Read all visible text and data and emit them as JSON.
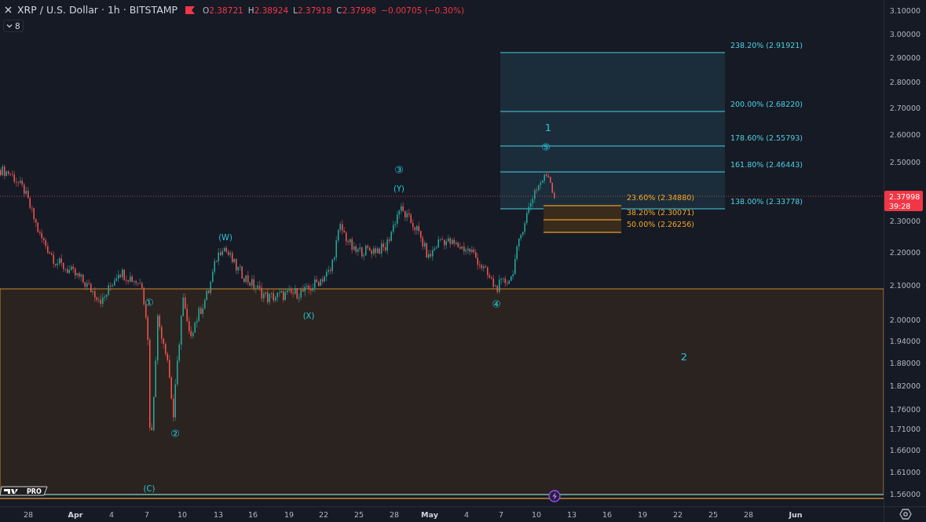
{
  "legend": {
    "symbol": "XRP / U.S. Dollar · 1h · BITSTAMP",
    "values": [
      {
        "key": "O",
        "value": "2.38721"
      },
      {
        "key": "H",
        "value": "2.38924"
      },
      {
        "key": "L",
        "value": "2.37918"
      },
      {
        "key": "C",
        "value": "2.37998"
      }
    ],
    "change": "−0.00705 (−0.30%)"
  },
  "indicators_toggle": {
    "count": "8"
  },
  "fib_extension": [
    {
      "label": "238.20% (2.91921)"
    },
    {
      "label": "200.00% (2.68220)"
    },
    {
      "label": "178.60% (2.55793)"
    },
    {
      "label": "161.80% (2.46443)"
    },
    {
      "label": "138.00% (2.33778)"
    }
  ],
  "fib_retracement": [
    {
      "label": "23.60% (2.34880)"
    },
    {
      "label": "38.20% (2.30071)"
    },
    {
      "label": "50.00% (2.26256)"
    }
  ],
  "wave_labels": [
    {
      "text": "①"
    },
    {
      "text": "②"
    },
    {
      "text": "③"
    },
    {
      "text": "④"
    },
    {
      "text": "⑤"
    },
    {
      "text": "(C)"
    },
    {
      "text": "(W)"
    },
    {
      "text": "(X)"
    },
    {
      "text": "(Y)"
    },
    {
      "text": "1"
    },
    {
      "text": "2"
    }
  ],
  "price_axis": [
    "3.10000",
    "3.00000",
    "2.90000",
    "2.80000",
    "2.70000",
    "2.60000",
    "2.50000",
    "2.30000",
    "2.20000",
    "2.10000",
    "2.00000",
    "1.94000",
    "1.88000",
    "1.82000",
    "1.76000",
    "1.71000",
    "1.66000",
    "1.61000",
    "1.56000"
  ],
  "last_price": {
    "value": "2.37998",
    "countdown": "39:28"
  },
  "time_axis": [
    {
      "text": "28",
      "kind": "day"
    },
    {
      "text": "Apr",
      "kind": "month"
    },
    {
      "text": "4",
      "kind": "day"
    },
    {
      "text": "7",
      "kind": "day"
    },
    {
      "text": "10",
      "kind": "day"
    },
    {
      "text": "13",
      "kind": "day"
    },
    {
      "text": "16",
      "kind": "day"
    },
    {
      "text": "19",
      "kind": "day"
    },
    {
      "text": "22",
      "kind": "day"
    },
    {
      "text": "25",
      "kind": "day"
    },
    {
      "text": "28",
      "kind": "day"
    },
    {
      "text": "May",
      "kind": "month"
    },
    {
      "text": "4",
      "kind": "day"
    },
    {
      "text": "7",
      "kind": "day"
    },
    {
      "text": "10",
      "kind": "day"
    },
    {
      "text": "13",
      "kind": "day"
    },
    {
      "text": "16",
      "kind": "day"
    },
    {
      "text": "19",
      "kind": "day"
    },
    {
      "text": "22",
      "kind": "day"
    },
    {
      "text": "25",
      "kind": "day"
    },
    {
      "text": "28",
      "kind": "day"
    },
    {
      "text": "Jun",
      "kind": "month"
    }
  ],
  "logo": {
    "badge": "PRO"
  }
}
